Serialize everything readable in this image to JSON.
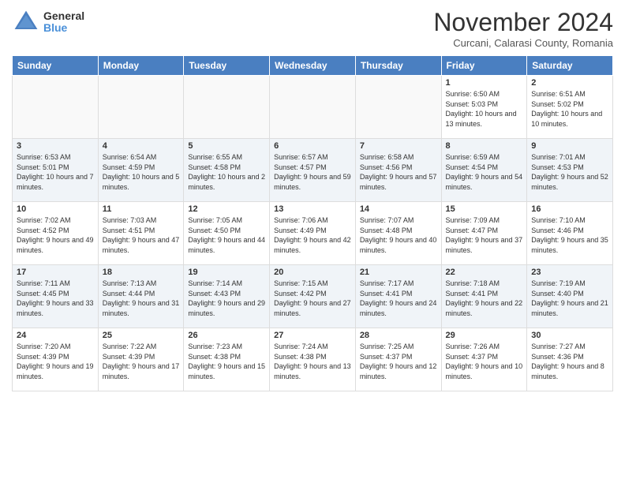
{
  "logo": {
    "general": "General",
    "blue": "Blue"
  },
  "title": "November 2024",
  "location": "Curcani, Calarasi County, Romania",
  "days_of_week": [
    "Sunday",
    "Monday",
    "Tuesday",
    "Wednesday",
    "Thursday",
    "Friday",
    "Saturday"
  ],
  "weeks": [
    [
      {
        "day": "",
        "info": ""
      },
      {
        "day": "",
        "info": ""
      },
      {
        "day": "",
        "info": ""
      },
      {
        "day": "",
        "info": ""
      },
      {
        "day": "",
        "info": ""
      },
      {
        "day": "1",
        "info": "Sunrise: 6:50 AM\nSunset: 5:03 PM\nDaylight: 10 hours and 13 minutes."
      },
      {
        "day": "2",
        "info": "Sunrise: 6:51 AM\nSunset: 5:02 PM\nDaylight: 10 hours and 10 minutes."
      }
    ],
    [
      {
        "day": "3",
        "info": "Sunrise: 6:53 AM\nSunset: 5:01 PM\nDaylight: 10 hours and 7 minutes."
      },
      {
        "day": "4",
        "info": "Sunrise: 6:54 AM\nSunset: 4:59 PM\nDaylight: 10 hours and 5 minutes."
      },
      {
        "day": "5",
        "info": "Sunrise: 6:55 AM\nSunset: 4:58 PM\nDaylight: 10 hours and 2 minutes."
      },
      {
        "day": "6",
        "info": "Sunrise: 6:57 AM\nSunset: 4:57 PM\nDaylight: 9 hours and 59 minutes."
      },
      {
        "day": "7",
        "info": "Sunrise: 6:58 AM\nSunset: 4:56 PM\nDaylight: 9 hours and 57 minutes."
      },
      {
        "day": "8",
        "info": "Sunrise: 6:59 AM\nSunset: 4:54 PM\nDaylight: 9 hours and 54 minutes."
      },
      {
        "day": "9",
        "info": "Sunrise: 7:01 AM\nSunset: 4:53 PM\nDaylight: 9 hours and 52 minutes."
      }
    ],
    [
      {
        "day": "10",
        "info": "Sunrise: 7:02 AM\nSunset: 4:52 PM\nDaylight: 9 hours and 49 minutes."
      },
      {
        "day": "11",
        "info": "Sunrise: 7:03 AM\nSunset: 4:51 PM\nDaylight: 9 hours and 47 minutes."
      },
      {
        "day": "12",
        "info": "Sunrise: 7:05 AM\nSunset: 4:50 PM\nDaylight: 9 hours and 44 minutes."
      },
      {
        "day": "13",
        "info": "Sunrise: 7:06 AM\nSunset: 4:49 PM\nDaylight: 9 hours and 42 minutes."
      },
      {
        "day": "14",
        "info": "Sunrise: 7:07 AM\nSunset: 4:48 PM\nDaylight: 9 hours and 40 minutes."
      },
      {
        "day": "15",
        "info": "Sunrise: 7:09 AM\nSunset: 4:47 PM\nDaylight: 9 hours and 37 minutes."
      },
      {
        "day": "16",
        "info": "Sunrise: 7:10 AM\nSunset: 4:46 PM\nDaylight: 9 hours and 35 minutes."
      }
    ],
    [
      {
        "day": "17",
        "info": "Sunrise: 7:11 AM\nSunset: 4:45 PM\nDaylight: 9 hours and 33 minutes."
      },
      {
        "day": "18",
        "info": "Sunrise: 7:13 AM\nSunset: 4:44 PM\nDaylight: 9 hours and 31 minutes."
      },
      {
        "day": "19",
        "info": "Sunrise: 7:14 AM\nSunset: 4:43 PM\nDaylight: 9 hours and 29 minutes."
      },
      {
        "day": "20",
        "info": "Sunrise: 7:15 AM\nSunset: 4:42 PM\nDaylight: 9 hours and 27 minutes."
      },
      {
        "day": "21",
        "info": "Sunrise: 7:17 AM\nSunset: 4:41 PM\nDaylight: 9 hours and 24 minutes."
      },
      {
        "day": "22",
        "info": "Sunrise: 7:18 AM\nSunset: 4:41 PM\nDaylight: 9 hours and 22 minutes."
      },
      {
        "day": "23",
        "info": "Sunrise: 7:19 AM\nSunset: 4:40 PM\nDaylight: 9 hours and 21 minutes."
      }
    ],
    [
      {
        "day": "24",
        "info": "Sunrise: 7:20 AM\nSunset: 4:39 PM\nDaylight: 9 hours and 19 minutes."
      },
      {
        "day": "25",
        "info": "Sunrise: 7:22 AM\nSunset: 4:39 PM\nDaylight: 9 hours and 17 minutes."
      },
      {
        "day": "26",
        "info": "Sunrise: 7:23 AM\nSunset: 4:38 PM\nDaylight: 9 hours and 15 minutes."
      },
      {
        "day": "27",
        "info": "Sunrise: 7:24 AM\nSunset: 4:38 PM\nDaylight: 9 hours and 13 minutes."
      },
      {
        "day": "28",
        "info": "Sunrise: 7:25 AM\nSunset: 4:37 PM\nDaylight: 9 hours and 12 minutes."
      },
      {
        "day": "29",
        "info": "Sunrise: 7:26 AM\nSunset: 4:37 PM\nDaylight: 9 hours and 10 minutes."
      },
      {
        "day": "30",
        "info": "Sunrise: 7:27 AM\nSunset: 4:36 PM\nDaylight: 9 hours and 8 minutes."
      }
    ]
  ]
}
